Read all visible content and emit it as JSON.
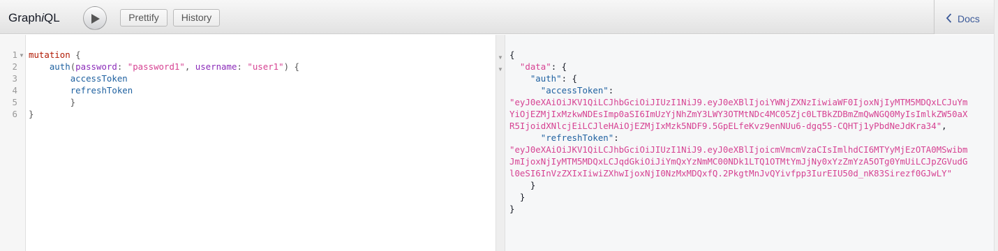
{
  "app": {
    "title_prefix": "Graph",
    "title_italic": "i",
    "title_suffix": "QL"
  },
  "toolbar": {
    "prettify_label": "Prettify",
    "history_label": "History",
    "run_icon": "play-icon"
  },
  "docs": {
    "label": "Docs",
    "icon": "chevron-left-icon"
  },
  "query": {
    "line_numbers": [
      "1",
      "2",
      "3",
      "4",
      "5",
      "6"
    ],
    "keyword": "mutation",
    "field": "auth",
    "arg1_name": "password",
    "arg1_value": "\"password1\"",
    "arg2_name": "username",
    "arg2_value": "\"user1\"",
    "sub1": "accessToken",
    "sub2": "refreshToken"
  },
  "result": {
    "data_key": "\"data\"",
    "auth_key": "\"auth\"",
    "access_key": "\"accessToken\"",
    "access_lines": [
      "\"eyJ0eXAiOiJKV1QiLCJhbGciOiJIUzI1NiJ9.eyJ0eXBlIjoiYWNjZXNzIiwiaWF0IjoxNjIyMTM5MDQxLCJuYm",
      "YiOjEZMjIxMzkwNDEsImp0aSI6ImUzYjNhZmY3LWY3OTMtNDc4MC05Zjc0LTBkZDBmZmQwNGQ0MyIsImlkZW50aX",
      "R5IjoidXNlcjEiLCJleHAiOjEZMjIxMzk5NDF9.5GpELfeKvz9enNUu6-dgq55-CQHTj1yPbdNeJdKra34\""
    ],
    "refresh_key": "\"refreshToken\"",
    "refresh_lines": [
      "\"eyJ0eXAiOiJKV1QiLCJhbGciOiJIUzI1NiJ9.eyJ0eXBlIjoicmVmcmVzaCIsImlhdCI6MTYyMjEzOTA0MSwibm",
      "JmIjoxNjIyMTM5MDQxLCJqdGkiOiJiYmQxYzNmMC00NDk1LTQ1OTMtYmJjNy0xYzZmYzA5OTg0YmUiLCJpZGVudG",
      "l0eSI6InVzZXIxIiwiZXhwIjoxNjI0NzMxMDQxfQ.2PkgtMnJvQYivfpp3IurEIU50d_nK83Sirezf0GJwLY\""
    ]
  },
  "colors": {
    "keyword": "#b11a04",
    "field": "#1f61a0",
    "attribute": "#8b2bb9",
    "string": "#d64292",
    "docs_link": "#3b5998"
  }
}
